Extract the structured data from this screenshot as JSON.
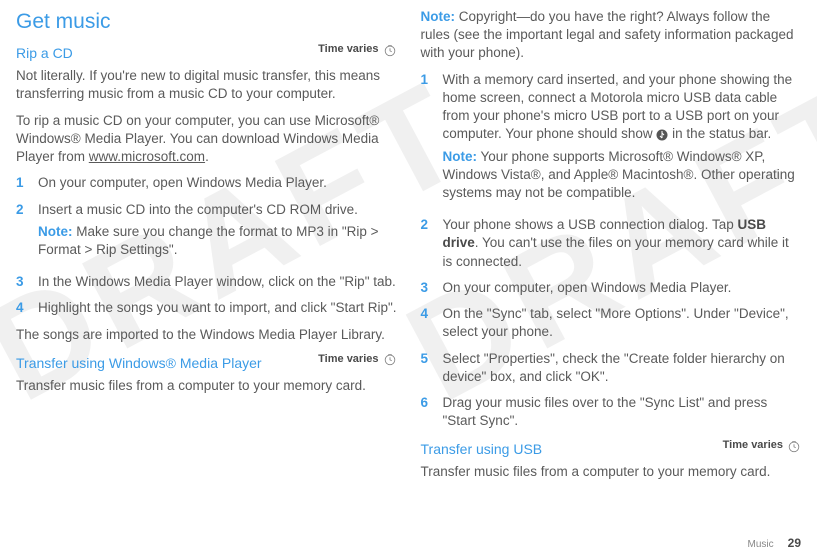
{
  "watermark": "DRAFT",
  "left": {
    "title": "Get music",
    "rip_heading": "Rip a CD",
    "time_varies": "Time varies",
    "rip_intro": "Not literally. If you're new to digital music transfer, this means transferring music from a music CD to your computer.",
    "rip_howto": "To rip a music CD on your computer, you can use Microsoft® Windows® Media Player. You can download Windows Media Player from ",
    "rip_link": "www.microsoft.com",
    "rip_link_suffix": ".",
    "steps": [
      "On your computer, open Windows Media Player.",
      "Insert a music CD into the computer's CD ROM drive.",
      "In the Windows Media Player window, click on the \"Rip\" tab.",
      "Highlight the songs you want to import, and click \"Start Rip\"."
    ],
    "step2_note_label": "Note:",
    "step2_note": " Make sure you change the format to MP3 in \"Rip > Format > Rip Settings\".",
    "rip_outro": "The songs are imported to the Windows Media Player Library.",
    "wmp_heading": "Transfer using Windows® Media Player",
    "wmp_intro": "Transfer music files from a computer to your memory card."
  },
  "right": {
    "copyright_note_label": "Note:",
    "copyright_note": " Copyright—do you have the right? Always follow the rules (see the important legal and safety information packaged with your phone).",
    "steps": [
      "With a memory card inserted, and your phone showing the home screen, connect a Motorola micro USB data cable from your phone's micro USB port to a USB port on your computer. Your phone should show ",
      "Your phone shows a USB connection dialog. Tap ",
      "On your computer, open Windows Media Player.",
      "On the \"Sync\" tab, select \"More Options\". Under \"Device\", select your phone.",
      "Select \"Properties\", check the \"Create folder hierarchy on device\" box, and click \"OK\".",
      "Drag your music files over to the \"Sync List\" and press \"Start Sync\"."
    ],
    "step1_suffix": " in the status bar.",
    "step1_note_label": "Note:",
    "step1_note": " Your phone supports Microsoft® Windows® XP, Windows Vista®, and Apple® Macintosh®. Other operating systems may not be compatible.",
    "step2_bold": "USB drive",
    "step2_suffix": ". You can't use the files on your memory card while it is connected.",
    "usb_heading": "Transfer using USB",
    "usb_intro": "Transfer music files from a computer to your memory card.",
    "time_varies": "Time varies"
  },
  "footer": {
    "section": "Music",
    "page": "29"
  }
}
